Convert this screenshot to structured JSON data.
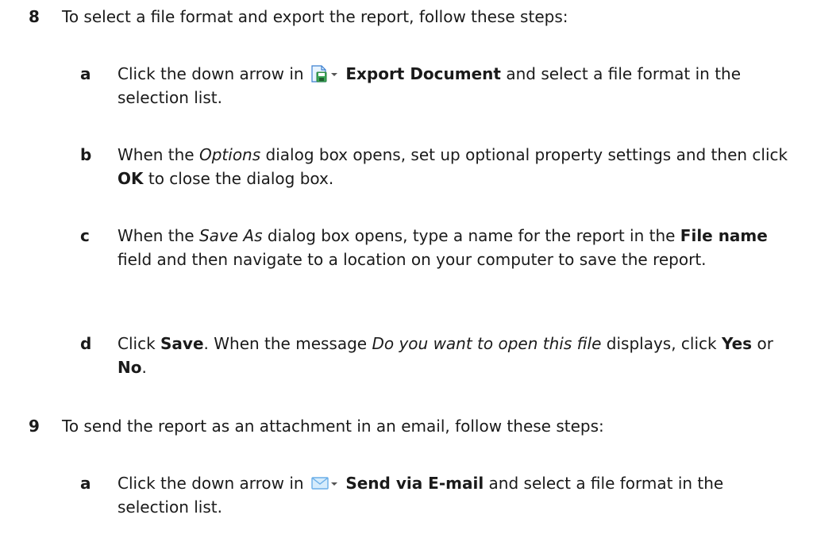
{
  "steps": [
    {
      "number": "8",
      "text": "To select a file format and export the report, follow these steps:",
      "substeps": [
        {
          "letter": "a",
          "pre": "Click the down arrow in",
          "icon": "export-document-icon",
          "bold": "Export Document",
          "post": "and select a file format in the selection list."
        },
        {
          "letter": "b",
          "p1": "When the",
          "i1": "Options",
          "p2": "dialog box opens, set up optional property settings and then click",
          "b1": "OK",
          "p3": "to close the dialog box."
        },
        {
          "letter": "c",
          "p1": "When the",
          "i1": "Save As",
          "p2": "dialog box opens, type a name for the report in the",
          "b1": "File name",
          "p3": "field and then navigate to a location on your computer to save the report."
        },
        {
          "letter": "d",
          "p1": "Click",
          "b1": "Save",
          "p2": ". When the message",
          "i1": "Do you want to open this file",
          "p3": "displays, click",
          "b2": "Yes",
          "p4": "or",
          "b3": "No",
          "p5": "."
        }
      ]
    },
    {
      "number": "9",
      "text": "To send the report as an attachment in an email, follow these steps:",
      "substeps": [
        {
          "letter": "a",
          "pre": "Click the down arrow in",
          "icon": "email-envelope-icon",
          "bold": "Send via E-mail",
          "post": "and select a file format in the selection list."
        }
      ]
    }
  ],
  "colors": {
    "text": "#1a1a1a",
    "icon_green": "#3aa655",
    "icon_blue": "#3b7fd0",
    "icon_envelope": "#6aaee8"
  }
}
